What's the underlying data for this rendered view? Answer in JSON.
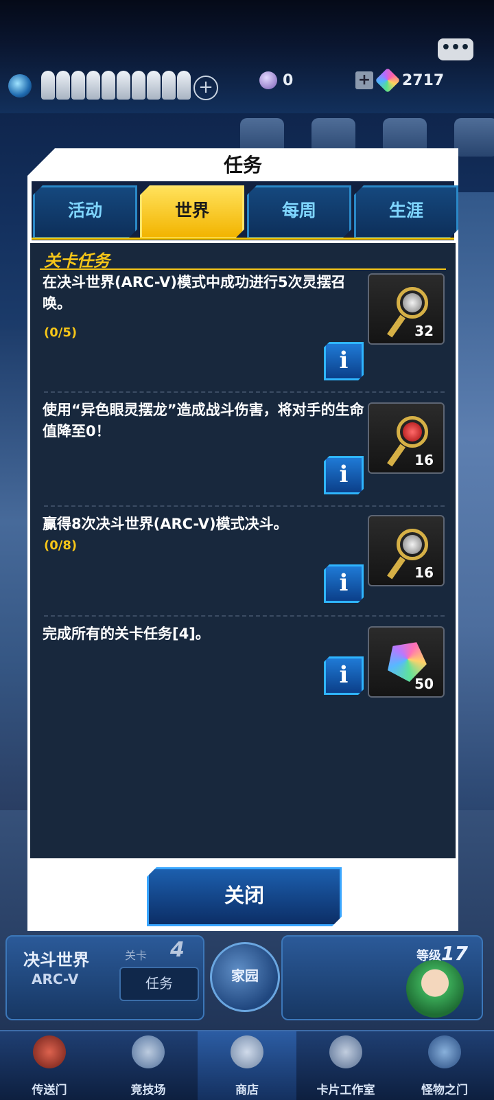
{
  "topbar": {
    "orb_count": "0",
    "gem_count": "2717"
  },
  "modal": {
    "title": "任务",
    "tabs": [
      {
        "label": "活动",
        "active": false
      },
      {
        "label": "世界",
        "active": true
      },
      {
        "label": "每周",
        "active": false
      },
      {
        "label": "生涯",
        "active": false
      }
    ],
    "section_title": "关卡任务",
    "missions": [
      {
        "text": "在决斗世界(ARC-V)模式中成功进行5次灵摆召唤。",
        "progress": "(0/5)",
        "reward_icon": "silver-key-icon",
        "reward_count": "32"
      },
      {
        "text": "使用“异色眼灵摆龙”造成战斗伤害，将对手的生命值降至0！",
        "progress": "",
        "reward_icon": "red-key-icon",
        "reward_count": "16"
      },
      {
        "text": "赢得8次决斗世界(ARC-V)模式决斗。",
        "progress": "(0/8)",
        "reward_icon": "silver-key-icon",
        "reward_count": "16"
      },
      {
        "text": "完成所有的关卡任务[4]。",
        "progress": "",
        "reward_icon": "gem-icon",
        "reward_count": "50"
      }
    ],
    "info_label": "i",
    "close_label": "关闭"
  },
  "duel": {
    "title": "决斗世界",
    "subtitle": "ARC-V",
    "stage_label": "关卡",
    "stage_number": "4",
    "mission_button": "任务"
  },
  "home_label": "家园",
  "player": {
    "level_label": "等级",
    "level": "17"
  },
  "nav": [
    {
      "label": "传送门",
      "icon": "portal-icon"
    },
    {
      "label": "竞技场",
      "icon": "swords-icon"
    },
    {
      "label": "商店",
      "icon": "shop-cart-icon"
    },
    {
      "label": "卡片工作室",
      "icon": "cards-icon"
    },
    {
      "label": "怪物之门",
      "icon": "monster-gate-icon"
    }
  ],
  "colors": {
    "accent_yellow": "#f5c518",
    "tab_blue": "#7fd6ff",
    "panel_bg": "#18283d"
  }
}
